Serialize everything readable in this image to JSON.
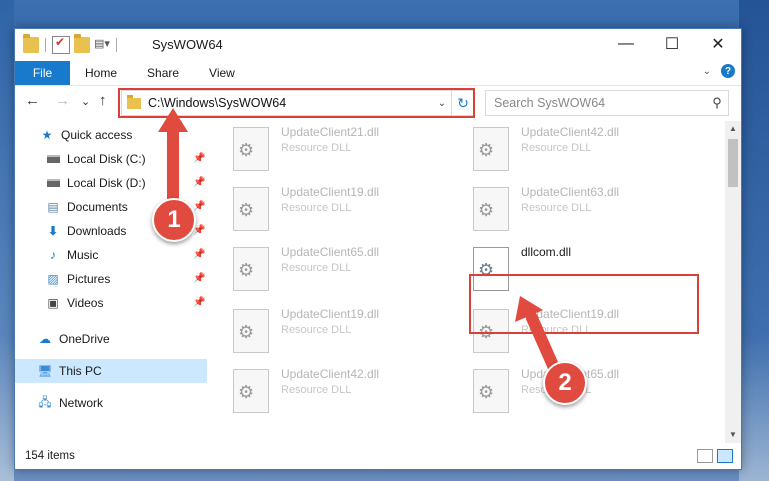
{
  "window": {
    "title": "SysWOW64",
    "controls": {
      "minimize": "—",
      "maximize": "☐",
      "close": "✕"
    }
  },
  "ribbon": {
    "file_tab": "File",
    "tabs": [
      "Home",
      "Share",
      "View"
    ]
  },
  "navigation": {
    "back": "←",
    "forward": "→",
    "recent": "⌄",
    "up": "↑",
    "address": "C:\\Windows\\SysWOW64",
    "search_placeholder": "Search SysWOW64"
  },
  "sidebar": {
    "items": [
      {
        "label": "Quick access",
        "icon": "star-icon",
        "pinned": false
      },
      {
        "label": "Local Disk (C:)",
        "icon": "drive-icon",
        "pinned": true
      },
      {
        "label": "Local Disk (D:)",
        "icon": "drive-icon",
        "pinned": true
      },
      {
        "label": "Documents",
        "icon": "documents-icon",
        "pinned": true
      },
      {
        "label": "Downloads",
        "icon": "download-icon",
        "pinned": true
      },
      {
        "label": "Music",
        "icon": "music-icon",
        "pinned": true
      },
      {
        "label": "Pictures",
        "icon": "pictures-icon",
        "pinned": true
      },
      {
        "label": "Videos",
        "icon": "videos-icon",
        "pinned": true
      },
      {
        "label": "OneDrive",
        "icon": "cloud-icon",
        "pinned": false
      },
      {
        "label": "This PC",
        "icon": "computer-icon",
        "pinned": false,
        "selected": true
      },
      {
        "label": "Network",
        "icon": "network-icon",
        "pinned": false
      }
    ]
  },
  "files": [
    {
      "name": "UpdateClient21.dll",
      "type": "Resource DLL",
      "active": false
    },
    {
      "name": "UpdateClient42.dll",
      "type": "Resource DLL",
      "active": false
    },
    {
      "name": "UpdateClient19.dll",
      "type": "Resource DLL",
      "active": false
    },
    {
      "name": "UpdateClient63.dll",
      "type": "Resource DLL",
      "active": false
    },
    {
      "name": "UpdateClient65.dll",
      "type": "Resource DLL",
      "active": false
    },
    {
      "name": "dllcom.dll",
      "type": "",
      "active": true
    },
    {
      "name": "UpdateClient19.dll",
      "type": "Resource DLL",
      "active": false
    },
    {
      "name": "UpdateClient19.dll",
      "type": "Resource DLL",
      "active": false
    },
    {
      "name": "UpdateClient42.dll",
      "type": "Resource DLL",
      "active": false
    },
    {
      "name": "UpdateClient65.dll",
      "type": "Resource DLL",
      "active": false
    }
  ],
  "status": {
    "item_count": "154 items"
  },
  "annotations": {
    "step1": "1",
    "step2": "2",
    "color": "#e04a3f"
  }
}
